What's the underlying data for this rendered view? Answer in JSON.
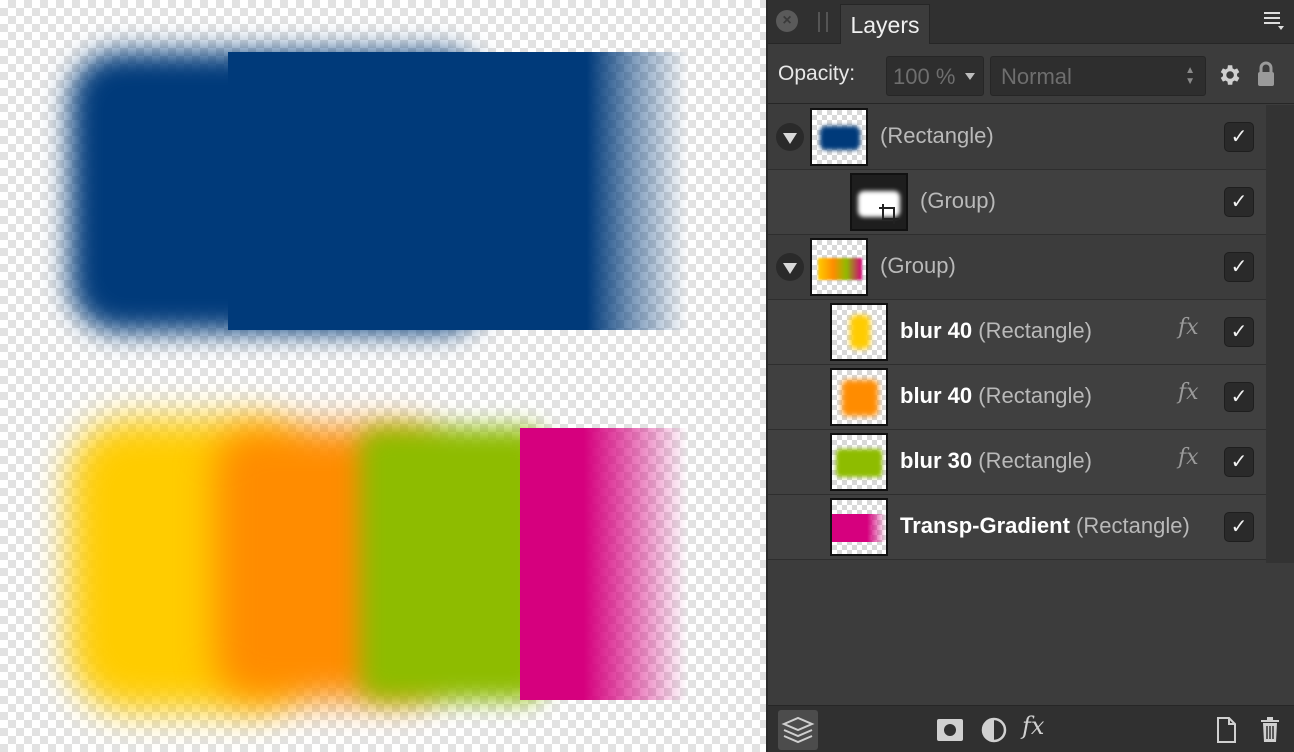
{
  "canvas": {
    "colors": {
      "blue": "#003a7a",
      "yellow": "#ffcc00",
      "orange": "#ff8c00",
      "green": "#8ebc00",
      "magenta": "#d6007e"
    }
  },
  "panel": {
    "tab_label": "Layers",
    "opacity_label": "Opacity:",
    "opacity_value": "100 %",
    "blend_mode": "Normal",
    "icons": [
      "close-icon",
      "menu-icon",
      "gear-icon",
      "lock-icon",
      "layers-icon",
      "mask-icon",
      "adjustment-icon",
      "fx-icon",
      "new-document-icon",
      "trash-icon"
    ],
    "fx_label": "fx",
    "checkmark": "✓",
    "layers": [
      {
        "name": "",
        "type": "(Rectangle)",
        "expanded": true,
        "checked": true,
        "fx": false
      },
      {
        "name": "",
        "type": "(Group)",
        "expanded": false,
        "checked": true,
        "fx": false
      },
      {
        "name": "",
        "type": "(Group)",
        "expanded": true,
        "checked": true,
        "fx": false
      },
      {
        "name": "blur 40",
        "type": "(Rectangle)",
        "expanded": false,
        "checked": true,
        "fx": true
      },
      {
        "name": "blur 40",
        "type": "(Rectangle)",
        "expanded": false,
        "checked": true,
        "fx": true
      },
      {
        "name": "blur 30",
        "type": "(Rectangle)",
        "expanded": false,
        "checked": true,
        "fx": true
      },
      {
        "name": "Transp-Gradient",
        "type": "(Rectangle)",
        "expanded": false,
        "checked": true,
        "fx": false
      }
    ]
  }
}
